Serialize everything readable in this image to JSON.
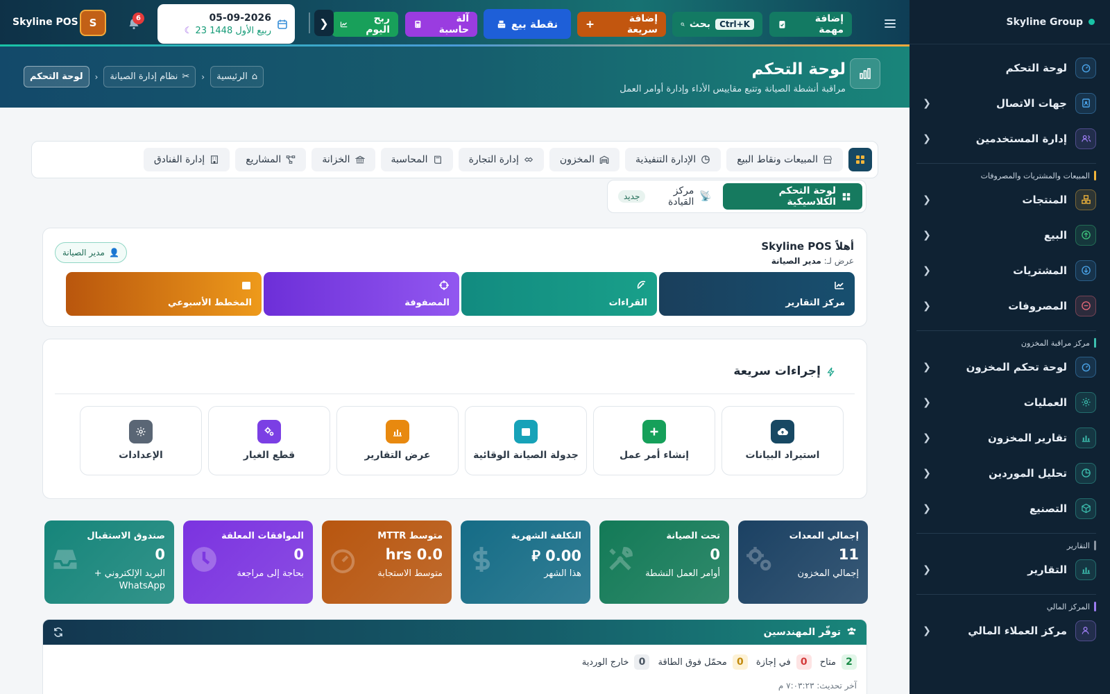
{
  "app": {
    "brand": "Skyline POS",
    "group": "Skyline Group",
    "avatar_letter": "S",
    "notifications": "6"
  },
  "topbar": {
    "add_task": "إضافة مهمة",
    "search": "بحث",
    "search_shortcut": "Ctrl+K",
    "quick_add": "إضافة سريعة",
    "pos": "نقطة بيع",
    "calculator": "آلة حاسبة",
    "today_profit": "ربح اليوم",
    "date_gregorian": "05-09-2026",
    "date_hijri": "23 ربيع الأول 1448"
  },
  "header": {
    "title": "لوحة التحكم",
    "subtitle": "مراقبة أنشطة الصيانة وتتبع مقاييس الأداء وإدارة أوامر العمل"
  },
  "breadcrumb": [
    {
      "label": "الرئيسية",
      "icon": "home-icon"
    },
    {
      "label": "نظام إدارة الصيانة",
      "icon": "tools-icon"
    },
    {
      "label": "لوحة التحكم",
      "icon": ""
    }
  ],
  "modules": [
    "المبيعات ونقاط البيع",
    "الإدارة التنفيذية",
    "المخزون",
    "إدارة التجارة",
    "المحاسبة",
    "الخزانة",
    "المشاريع",
    "إدارة الفنادق"
  ],
  "views": {
    "classic": "لوحة التحكم الكلاسيكية",
    "command": "مركز القيادة",
    "new_badge": "جديد"
  },
  "welcome": {
    "title": "أهلاً Skyline POS",
    "view_as_label": "عرض لـ:",
    "view_as_role": "مدير الصيانة",
    "role_badge": "مدير الصيانة",
    "tiles": [
      {
        "label": "مركز التقارير",
        "icon": "chart-line-icon",
        "color": "#1a3f5c"
      },
      {
        "label": "القراءات",
        "icon": "satellite-dish-icon",
        "color": "#148a7e"
      },
      {
        "label": "المصفوفة",
        "icon": "crosshair-icon",
        "color": "#7a3ce0"
      },
      {
        "label": "المخطط الأسبوعي",
        "icon": "calendar-icon",
        "color": "#d77b0f"
      }
    ]
  },
  "quick_actions": {
    "title": "إجراءات سريعة",
    "items": [
      {
        "label": "استيراد البيانات",
        "icon": "cloud-upload-icon",
        "color": "#174863"
      },
      {
        "label": "إنشاء أمر عمل",
        "icon": "plus-icon",
        "color": "#16a05a"
      },
      {
        "label": "جدولة الصيانة الوقائية",
        "icon": "calendar-icon",
        "color": "#17a2b8"
      },
      {
        "label": "عرض التقارير",
        "icon": "bar-chart-icon",
        "color": "#e8890f"
      },
      {
        "label": "قطع الغيار",
        "icon": "cogs-icon",
        "color": "#7b3fe4"
      },
      {
        "label": "الإعدادات",
        "icon": "gear-icon",
        "color": "#5a6675"
      }
    ]
  },
  "stats": [
    {
      "title": "إجمالي المعدات",
      "value": "11",
      "sub": "إجمالي المخزون",
      "icon": "cogs-icon",
      "color": "#1b4163"
    },
    {
      "title": "تحت الصيانة",
      "value": "0",
      "sub": "أوامر العمل النشطة",
      "icon": "tools-icon",
      "color": "#137a57"
    },
    {
      "title": "التكلفة الشهرية",
      "value": "0.00 ⃁",
      "sub": "هذا الشهر",
      "icon": "dollar-icon",
      "color": "#156c86"
    },
    {
      "title": "متوسط MTTR",
      "value": "0.0 hrs",
      "sub": "متوسط الاستجابة",
      "icon": "gauge-icon",
      "color": "#b8560f"
    },
    {
      "title": "الموافقات المعلقة",
      "value": "0",
      "sub": "بحاجة إلى مراجعة",
      "icon": "clock-icon",
      "color": "#7b33e0"
    },
    {
      "title": "صندوق الاستقبال",
      "value": "0",
      "sub": "البريد الإلكتروني + WhatsApp",
      "icon": "inbox-icon",
      "color": "#16857a"
    }
  ],
  "engineers": {
    "title": "توفّر المهندسين",
    "chips": [
      {
        "label": "متاح",
        "count": "2",
        "bg": "#e2f6e9",
        "fg": "#178a45"
      },
      {
        "label": "في إجازة",
        "count": "0",
        "bg": "#fde4e4",
        "fg": "#d33b3b"
      },
      {
        "label": "محمّل فوق الطاقة",
        "count": "0",
        "bg": "#fdf2d6",
        "fg": "#c28a0d"
      },
      {
        "label": "خارج الوردية",
        "count": "0",
        "bg": "#eceef1",
        "fg": "#4a5562"
      }
    ],
    "last_update": "آخر تحديث: ٧:٠٣:٢٣ م"
  },
  "sidebar": {
    "items_top": [
      {
        "label": "لوحة التحكم",
        "icon": "gauge-icon",
        "color": "#4aa3e8",
        "chevron": false
      },
      {
        "label": "جهات الاتصال",
        "icon": "contact-book-icon",
        "color": "#4aa3e8",
        "chevron": true
      },
      {
        "label": "إدارة المستخدمين",
        "icon": "users-icon",
        "color": "#9b7cf0",
        "chevron": true
      }
    ],
    "section_sales": "المبيعات والمشتريات والمصروفات",
    "items_sales": [
      {
        "label": "المنتجات",
        "icon": "boxes-icon",
        "color": "#f2b53b",
        "chevron": true
      },
      {
        "label": "البيع",
        "icon": "arrow-up-circle-icon",
        "color": "#3dc07a",
        "chevron": true
      },
      {
        "label": "المشتريات",
        "icon": "arrow-down-circle-icon",
        "color": "#4aa3e8",
        "chevron": true
      },
      {
        "label": "المصروفات",
        "icon": "minus-circle-icon",
        "color": "#e86a7a",
        "chevron": true
      }
    ],
    "section_inventory": "مركز مراقبة المخزون",
    "items_inventory": [
      {
        "label": "لوحة تحكم المخزون",
        "icon": "gauge-icon",
        "color": "#4aa3e8",
        "chevron": true
      },
      {
        "label": "العمليات",
        "icon": "gear-icon",
        "color": "#3dc0b0",
        "chevron": true
      },
      {
        "label": "تقارير المخزون",
        "icon": "bar-chart-icon",
        "color": "#3dc0b0",
        "chevron": true
      },
      {
        "label": "تحليل الموردين",
        "icon": "pie-chart-icon",
        "color": "#3dc0b0",
        "chevron": true
      },
      {
        "label": "التصنيع",
        "icon": "cube-icon",
        "color": "#3dc0b0",
        "chevron": true
      }
    ],
    "section_reports": "التقارير",
    "items_reports": [
      {
        "label": "التقارير",
        "icon": "bar-chart-icon",
        "color": "#3dc0b0",
        "chevron": true
      }
    ],
    "section_finance": "المركز المالي",
    "items_finance": [
      {
        "label": "مركز العملاء المالي",
        "icon": "user-dollar-icon",
        "color": "#9b7cf0",
        "chevron": true
      }
    ]
  },
  "colors": {
    "primary": "#174863",
    "accent": "#19c3a6"
  }
}
